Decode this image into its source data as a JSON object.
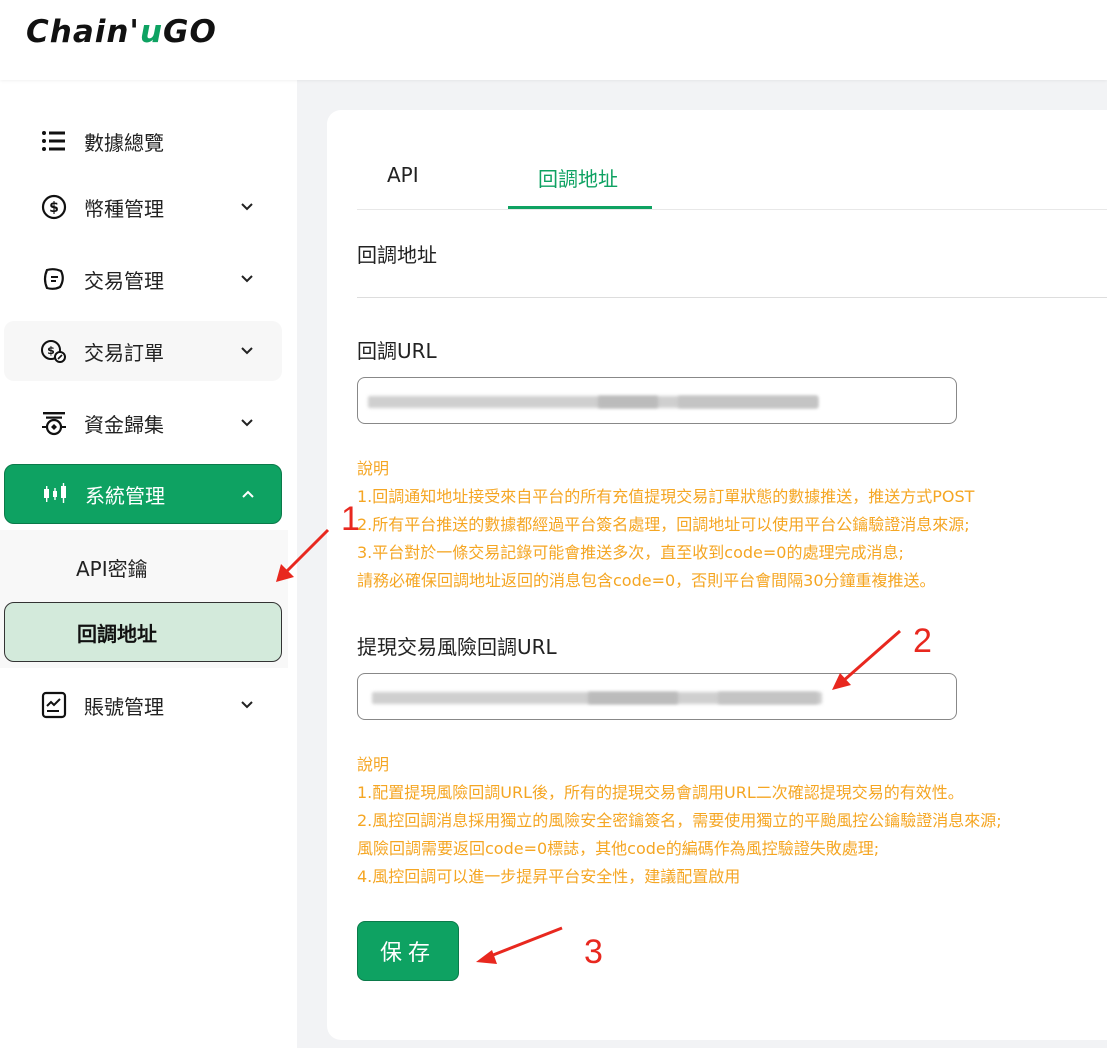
{
  "brand": {
    "logo_part1": "Chain'",
    "logo_u": "u",
    "logo_part2": "GO"
  },
  "sidebar": {
    "items": [
      {
        "label": "數據總覽",
        "icon": "list-icon"
      },
      {
        "label": "幣種管理",
        "icon": "dollar-circle-icon"
      },
      {
        "label": "交易管理",
        "icon": "exchange-icon"
      },
      {
        "label": "交易訂單",
        "icon": "coins-icon"
      },
      {
        "label": "資金歸集",
        "icon": "fund-collect-icon"
      },
      {
        "label": "系統管理",
        "icon": "candlestick-icon"
      },
      {
        "label": "賬號管理",
        "icon": "account-icon"
      }
    ],
    "sub_items": [
      {
        "label": "API密鑰"
      },
      {
        "label": "回調地址"
      }
    ]
  },
  "tabs": [
    {
      "label": "API"
    },
    {
      "label": "回調地址"
    }
  ],
  "main": {
    "section_title": "回調地址",
    "callback_url_label": "回調URL",
    "callback_note": [
      "說明",
      "1.回調通知地址接受來自平台的所有充值提現交易訂單狀態的數據推送，推送方式POST",
      "2.所有平台推送的數據都經過平台簽名處理，回調地址可以使用平台公鑰驗證消息來源;",
      "3.平台對於一條交易記錄可能會推送多次，直至收到code=0的處理完成消息;",
      "請務必確保回調地址返回的消息包含code=0，否則平台會間隔30分鐘重複推送。"
    ],
    "risk_url_label": "提現交易風險回調URL",
    "risk_note": [
      "說明",
      "1.配置提現風險回調URL後，所有的提現交易會調用URL二次確認提現交易的有效性。",
      "2.風控回調消息採用獨立的風險安全密鑰簽名，需要使用獨立的平颱風控公鑰驗證消息來源;",
      "風險回調需要返回code=0標誌，其他code的編碼作為風控驗證失敗處理;",
      "4.風控回調可以進一步提昇平台安全性，建議配置啟用"
    ],
    "save_label": "保存"
  },
  "annotations": {
    "n1": "1",
    "n2": "2",
    "n3": "3"
  },
  "colors": {
    "accent": "#0ea262",
    "note": "#f5a623",
    "annotation": "#e8281f"
  }
}
